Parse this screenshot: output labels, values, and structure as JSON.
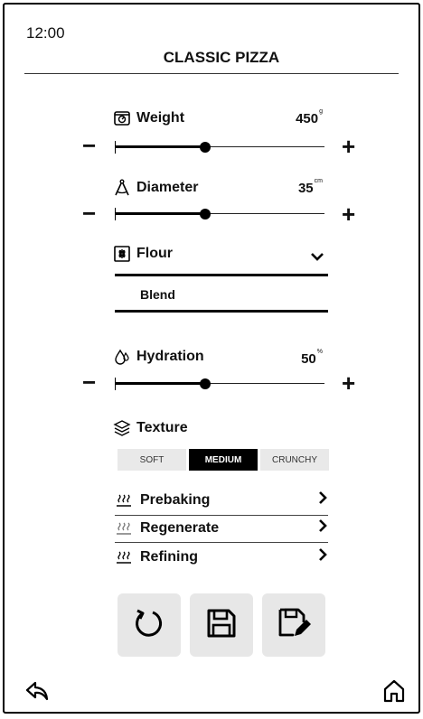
{
  "status": {
    "time": "12:00"
  },
  "header": {
    "title": "CLASSIC PIZZA"
  },
  "weight": {
    "label": "Weight",
    "value": "450",
    "unit": "g",
    "level": 0.43
  },
  "diameter": {
    "label": "Diameter",
    "value": "35",
    "unit": "cm",
    "level": 0.43
  },
  "flour": {
    "label": "Flour",
    "value": "Blend"
  },
  "hydration": {
    "label": "Hydration",
    "value": "50",
    "unit": "%",
    "level": 0.43
  },
  "texture": {
    "label": "Texture",
    "options": [
      "SOFT",
      "MEDIUM",
      "CRUNCHY"
    ],
    "selected": "MEDIUM"
  },
  "settings": [
    {
      "label": "Prebaking",
      "icon": "heat-waves-icon"
    },
    {
      "label": "Regenerate",
      "icon": "heat-waves-icon"
    },
    {
      "label": "Refining",
      "icon": "heat-waves-icon"
    }
  ],
  "controls": {
    "minus": "−",
    "plus": "+"
  },
  "actions": [
    "reset-icon",
    "save-icon",
    "edit-icon"
  ],
  "nav": {
    "back": "back-arrow-icon",
    "home": "home-icon"
  }
}
